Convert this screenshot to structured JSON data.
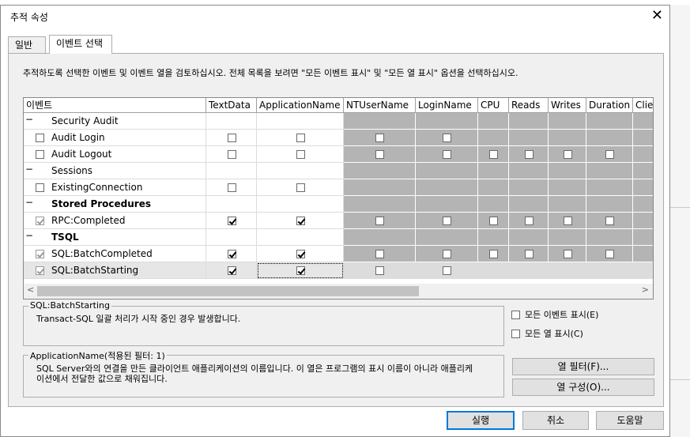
{
  "dialog": {
    "title": "추적 속성",
    "close_glyph": "✕"
  },
  "tabs": [
    {
      "label": "일반",
      "active": false
    },
    {
      "label": "이벤트 선택",
      "active": true
    }
  ],
  "instruction": "추적하도록 선택한 이벤트 및 이벤트 열을 검토하십시오. 전체 목록을 보려면 \"모든 이벤트 표시\" 및 \"모든 열 표시\" 옵션을 선택하십시오.",
  "grid": {
    "columns": [
      "이벤트",
      "TextData",
      "ApplicationName",
      "NTUserName",
      "LoginName",
      "CPU",
      "Reads",
      "Writes",
      "Duration",
      "Clie"
    ],
    "collapse_glyph": "−",
    "rows": [
      {
        "kind": "category",
        "label": "Security Audit",
        "bold": false
      },
      {
        "kind": "event",
        "label": "Audit Login",
        "checked": false,
        "cells": [
          "off",
          "off",
          "off",
          "off",
          null,
          null,
          null,
          null,
          null
        ]
      },
      {
        "kind": "event",
        "label": "Audit Logout",
        "checked": false,
        "cells": [
          "off",
          "off",
          "off",
          "off",
          "off",
          "off",
          "off",
          "off",
          null
        ]
      },
      {
        "kind": "category",
        "label": "Sessions",
        "bold": false
      },
      {
        "kind": "event",
        "label": "ExistingConnection",
        "checked": false,
        "cells": [
          "off",
          "off",
          null,
          null,
          null,
          null,
          null,
          null,
          null
        ]
      },
      {
        "kind": "category",
        "label": "Stored Procedures",
        "bold": true
      },
      {
        "kind": "event",
        "label": "RPC:Completed",
        "checked": true,
        "cells": [
          "on",
          "on",
          "off",
          "off",
          "off",
          "off",
          "off",
          "off",
          null
        ]
      },
      {
        "kind": "category",
        "label": "TSQL",
        "bold": true
      },
      {
        "kind": "event",
        "label": "SQL:BatchCompleted",
        "checked": true,
        "cells": [
          "on",
          "on",
          "off",
          "off",
          "off",
          "off",
          "off",
          "off",
          null
        ]
      },
      {
        "kind": "event",
        "label": "SQL:BatchStarting",
        "checked": true,
        "selected": true,
        "cells": [
          "on",
          "on",
          "off",
          "off",
          null,
          null,
          null,
          null,
          null
        ]
      }
    ],
    "scroll_left": "<",
    "scroll_right": ">"
  },
  "event_desc": {
    "title": "SQL:BatchStarting",
    "text": "Transact-SQL 일괄 처리가 시작 중인 경우 발생합니다."
  },
  "column_desc": {
    "title": "ApplicationName(적용된 필터: 1)",
    "line1": "SQL Server와의 연결을 만든 클라이언트 애플리케이션의 이름입니다. 이 열은 프로그램의 표시 이름이 아니라 애플리케",
    "line2": "이션에서 전달한 값으로 채워집니다."
  },
  "options": {
    "show_all_events": "모든 이벤트 표시(E)",
    "show_all_columns": "모든 열 표시(C)"
  },
  "buttons": {
    "column_filter": "열 필터(F)...",
    "column_organize": "열 구성(O)...",
    "run": "실행",
    "cancel": "취소",
    "help": "도움말"
  }
}
